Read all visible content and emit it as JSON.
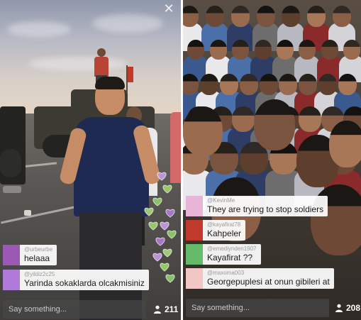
{
  "app": {
    "viewer_placeholder": "Say something..."
  },
  "left_stream": {
    "comments": [
      {
        "user": "@urbeurbe",
        "text": "helaaa",
        "color": "#9b59b6"
      },
      {
        "user": "@yildiz2c25",
        "text": "Yarinda sokaklarda olcakmisiniz",
        "color": "#b07ad8"
      }
    ],
    "compose_placeholder": "Say something...",
    "viewer_count": "211",
    "heart_colors": [
      "#c79be6",
      "#9fd46b",
      "#8fcf6a",
      "#b07ad8",
      "#a8d87a"
    ]
  },
  "right_stream": {
    "comments": [
      {
        "user": "@KevinMe",
        "text": "They are trying to stop soldiers",
        "color": "#e8b4d8"
      },
      {
        "user": "@kayafirat78",
        "text": "Kahpeler",
        "color": "#c0392b"
      },
      {
        "user": "@emediynden1907",
        "text": "Kayafirat ??",
        "color": "#66bb6a"
      },
      {
        "user": "@maxoma003",
        "text": "Georgepuplesi at onun gibileri at",
        "color": "#f3c6c6"
      }
    ],
    "compose_placeholder": "Say something...",
    "viewer_count": "208"
  },
  "icons": {
    "close": "close-icon",
    "viewers": "person-icon",
    "heart": "heart-icon"
  }
}
